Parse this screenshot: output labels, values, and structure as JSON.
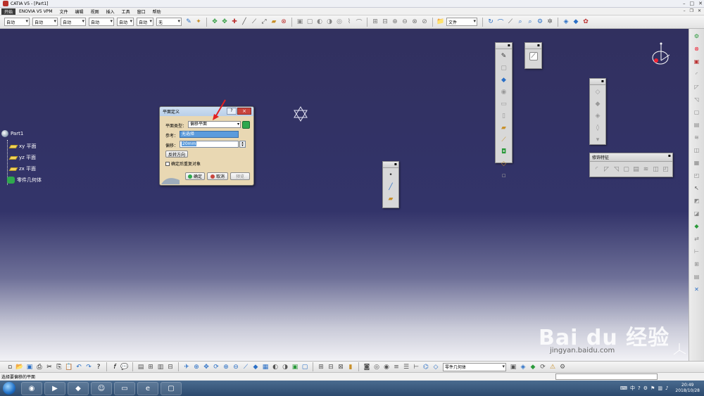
{
  "window": {
    "title": "CATIA V5 - [Part1]"
  },
  "menubar": {
    "start": "开始",
    "items": [
      "ENOVIA V5 VPM",
      "文件",
      "编辑",
      "视图",
      "插入",
      "工具",
      "窗口",
      "帮助"
    ]
  },
  "toolbar": {
    "selects": [
      {
        "value": "自动",
        "width": 35
      },
      {
        "value": "自动",
        "width": 35
      },
      {
        "value": "自动",
        "width": 35
      },
      {
        "value": "自动",
        "width": 35
      },
      {
        "value": "自动",
        "width": 20
      },
      {
        "value": "自动",
        "width": 20
      },
      {
        "value": "无",
        "width": 35
      }
    ],
    "file_select": "文件"
  },
  "tree": {
    "root": "Part1",
    "planes": [
      "xy 平面",
      "yz 平面",
      "zx 平面"
    ],
    "body": "零件几何体"
  },
  "dialog": {
    "title": "平面定义",
    "help": "?",
    "close": "×",
    "type_label": "平面类型：",
    "type_value": "偏移平面",
    "ref_label": "参考：",
    "ref_value": "无选择",
    "offset_label": "偏移：",
    "offset_value": "20mm",
    "reverse_button": "反转方向",
    "repeat_checkbox": "确定后重复对象",
    "ok_button": "确定",
    "cancel_button": "取消",
    "preview_button": "预览"
  },
  "float_toolbars": {
    "decor_title": "修饰特征"
  },
  "bottom_toolbar": {
    "select_value": "零件几何体"
  },
  "status": {
    "text": "选择要偏移的平面"
  },
  "taskbar": {
    "time": "20:49",
    "date": "2018/10/28"
  },
  "watermark": {
    "main": "Bai du 经验",
    "sub": "jingyan.baidu.com"
  },
  "colors": {
    "viewport_top": "#31305f",
    "viewport_bottom": "#f2f2f6",
    "dialog_bg": "#e9d8b3",
    "accent_red": "#c9463d"
  }
}
